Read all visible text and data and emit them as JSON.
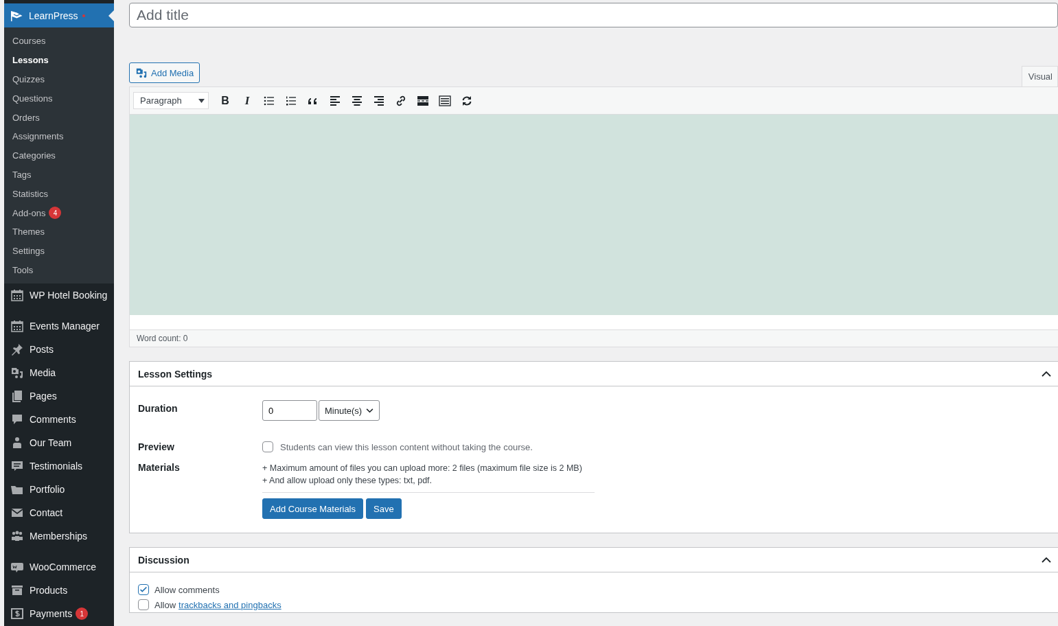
{
  "sidebar": {
    "header": {
      "label": "LearnPress",
      "selected": true,
      "notification_dot": true
    },
    "submenu": [
      {
        "label": "Courses",
        "selected": false
      },
      {
        "label": "Lessons",
        "selected": true
      },
      {
        "label": "Quizzes",
        "selected": false
      },
      {
        "label": "Questions",
        "selected": false
      },
      {
        "label": "Orders",
        "selected": false
      },
      {
        "label": "Assignments",
        "selected": false
      },
      {
        "label": "Categories",
        "selected": false
      },
      {
        "label": "Tags",
        "selected": false
      },
      {
        "label": "Statistics",
        "selected": false
      },
      {
        "label": "Add-ons",
        "selected": false,
        "badge": "4"
      },
      {
        "label": "Themes",
        "selected": false
      },
      {
        "label": "Settings",
        "selected": false
      },
      {
        "label": "Tools",
        "selected": false
      }
    ],
    "groups": [
      {
        "items": [
          {
            "label": "WP Hotel Booking"
          }
        ]
      },
      {
        "items": [
          {
            "label": "Events Manager"
          },
          {
            "label": "Posts"
          },
          {
            "label": "Media"
          },
          {
            "label": "Pages"
          },
          {
            "label": "Comments"
          },
          {
            "label": "Our Team"
          },
          {
            "label": "Testimonials"
          },
          {
            "label": "Portfolio"
          },
          {
            "label": "Contact"
          },
          {
            "label": "Memberships"
          }
        ]
      },
      {
        "items": [
          {
            "label": "WooCommerce"
          },
          {
            "label": "Products"
          },
          {
            "label": "Payments",
            "badge": "1"
          }
        ]
      }
    ]
  },
  "title_field": {
    "placeholder": "Add title"
  },
  "add_media_button": "Add Media",
  "editor": {
    "tabs": [
      {
        "label": "Visual",
        "selected": true
      }
    ],
    "format_select": "Paragraph",
    "toolbar": [
      {
        "kind": "bold",
        "label": "B"
      },
      {
        "kind": "italic",
        "label": "I"
      },
      {
        "kind": "bullet-list"
      },
      {
        "kind": "numbered-list"
      },
      {
        "kind": "quote"
      },
      {
        "kind": "align-left"
      },
      {
        "kind": "align-center"
      },
      {
        "kind": "align-right"
      },
      {
        "kind": "link"
      },
      {
        "kind": "read-more"
      },
      {
        "kind": "keyboard"
      },
      {
        "kind": "refresh"
      }
    ],
    "word_count": "Word count: 0"
  },
  "lesson_settings": {
    "title": "Lesson Settings",
    "expanded": true,
    "duration": {
      "label": "Duration",
      "value": "0",
      "unit": "Minute(s)"
    },
    "preview": {
      "label": "Preview",
      "checked": false,
      "text": "Students can view this lesson content without taking the course."
    },
    "materials": {
      "label": "Materials",
      "notes": [
        "+ Maximum amount of files you can upload more: 2 files (maximum file size is 2 MB)",
        "+ And allow upload only these types: txt, pdf."
      ],
      "buttons": [
        "Add Course Materials",
        "Save"
      ]
    }
  },
  "discussion": {
    "title": "Discussion",
    "expanded": true,
    "options": [
      {
        "text": "Allow comments",
        "checked": true
      },
      {
        "text": "Allow",
        "link": "trackbacks and pingbacks",
        "checked": false
      }
    ]
  }
}
